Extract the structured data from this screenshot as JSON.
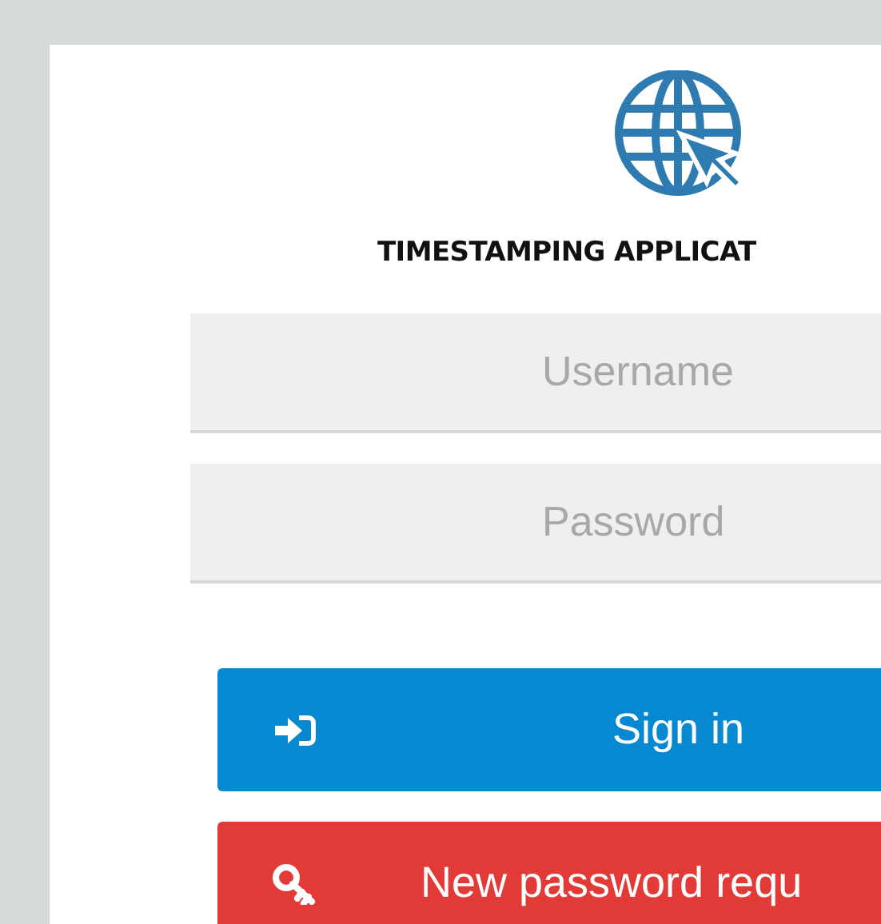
{
  "app": {
    "title": "TIMESTAMPING APPLICAT"
  },
  "fields": [
    {
      "placeholder": "Username"
    },
    {
      "placeholder": "Password"
    }
  ],
  "buttons": [
    {
      "label": "Sign in",
      "kind": "signin"
    },
    {
      "label": "New password requ",
      "kind": "reset"
    }
  ]
}
